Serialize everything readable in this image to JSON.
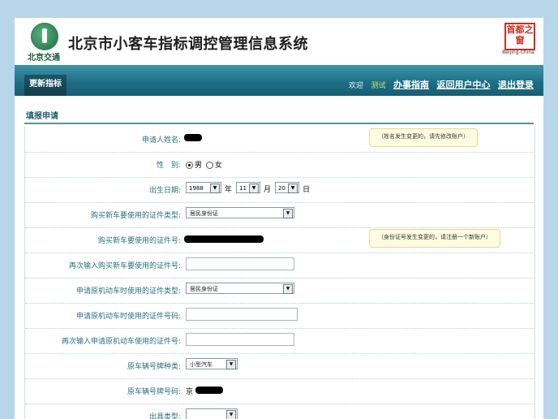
{
  "header": {
    "logo_text": "北京交通",
    "site_title": "北京市小客车指标调控管理信息系统",
    "seal_text": "首都之窗",
    "seal_caption": "Beijing-China"
  },
  "nav": {
    "tab": "更新指标",
    "welcome": "欢迎",
    "user": "测试",
    "links": [
      "办事指南",
      "返回用户中心",
      "退出登录"
    ]
  },
  "section_title": "填报申请",
  "form": {
    "applicant_name": {
      "label": "申请人姓名:",
      "note": "（姓名发生变更的，请先修改账户）"
    },
    "gender": {
      "label": "性　别:",
      "options": [
        "男",
        "女"
      ],
      "selected": "男"
    },
    "birth_date": {
      "label": "出生日期:",
      "year": "1988",
      "year_unit": "年",
      "month": "11",
      "month_unit": "月",
      "day": "20",
      "day_unit": "日"
    },
    "new_car_id_type": {
      "label": "购买新车要使用的证件类型:",
      "value": "居民身份证"
    },
    "new_car_id_no": {
      "label": "购买新车要使用的证件号:",
      "note": "（身份证号发生变更的，请注册一个新账户）"
    },
    "new_car_id_no_confirm": {
      "label": "再次输入购买新车要使用的证件号:",
      "value": ""
    },
    "old_car_id_type": {
      "label": "申请原机动车时使用的证件类型:",
      "value": "居民身份证"
    },
    "old_car_id_no": {
      "label": "申请原机动车时使用的证件号码:",
      "value": ""
    },
    "old_car_id_no_confirm": {
      "label": "再次输入申请原机动车使用的证件号:",
      "value": ""
    },
    "plate_type": {
      "label": "原车辆号牌种类:",
      "value": "小型汽车"
    },
    "plate_no": {
      "label": "原车辆号牌号码:",
      "prefix": "京"
    },
    "partial_row": {
      "label": "出具类型:",
      "value": ""
    }
  }
}
